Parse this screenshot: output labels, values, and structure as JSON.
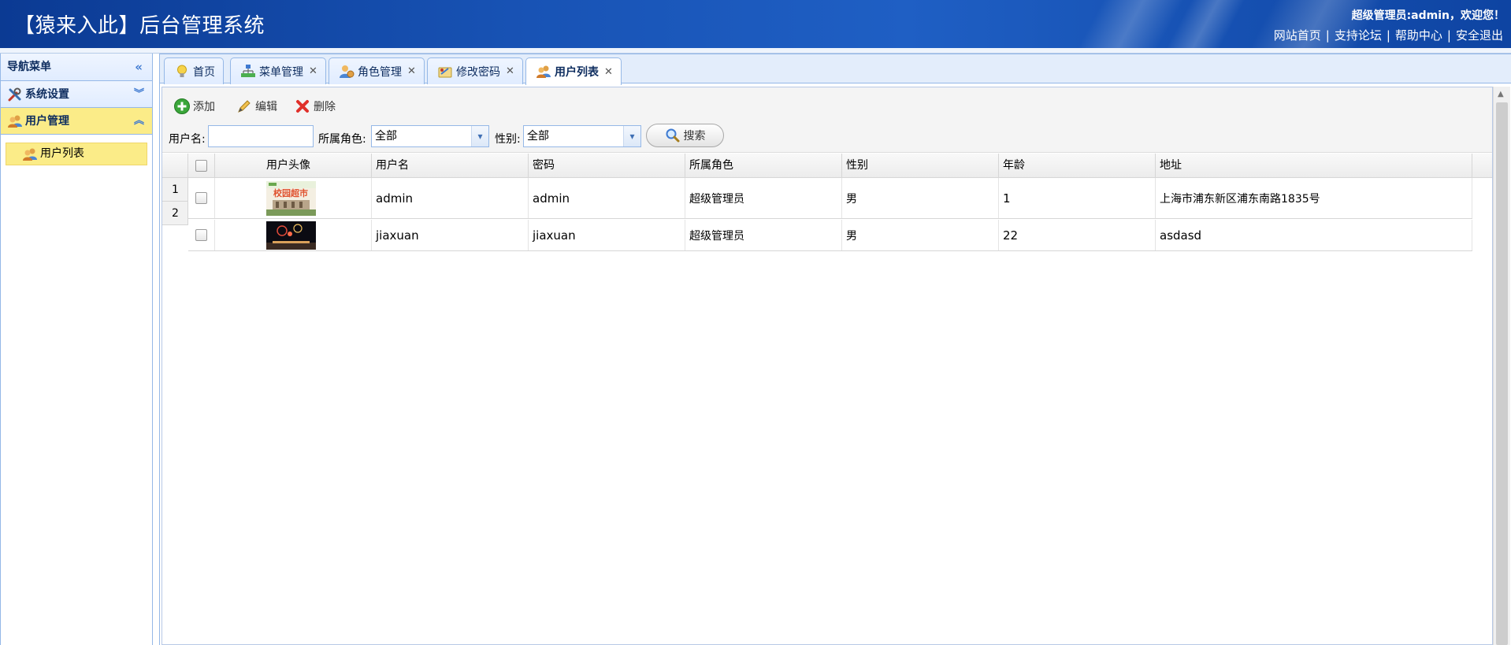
{
  "header": {
    "title": "【猿来入此】后台管理系统",
    "welcome": "超级管理员:admin，欢迎您！",
    "links": [
      "网站首页",
      "支持论坛",
      "帮助中心",
      "安全退出"
    ]
  },
  "sidebar": {
    "title": "导航菜单",
    "sections": [
      {
        "label": "系统设置",
        "icon": "tools-icon",
        "expanded": false
      },
      {
        "label": "用户管理",
        "icon": "users-icon",
        "expanded": true
      }
    ],
    "items": [
      {
        "label": "用户列表",
        "icon": "users-icon",
        "selected": true
      }
    ]
  },
  "tabs": [
    {
      "label": "首页",
      "icon": "lightbulb-icon",
      "closable": false,
      "selected": false
    },
    {
      "label": "菜单管理",
      "icon": "sitemap-icon",
      "closable": true,
      "selected": false
    },
    {
      "label": "角色管理",
      "icon": "role-icon",
      "closable": true,
      "selected": false
    },
    {
      "label": "修改密码",
      "icon": "password-icon",
      "closable": true,
      "selected": false
    },
    {
      "label": "用户列表",
      "icon": "users-icon",
      "closable": true,
      "selected": true
    }
  ],
  "toolbar": {
    "add_label": "添加",
    "edit_label": "编辑",
    "delete_label": "删除"
  },
  "filters": {
    "username_label": "用户名:",
    "username_value": "",
    "role_label": "所属角色:",
    "role_value": "全部",
    "sex_label": "性别:",
    "sex_value": "全部",
    "search_label": "搜索"
  },
  "grid": {
    "columns": [
      "用户头像",
      "用户名",
      "密码",
      "所属角色",
      "性别",
      "年龄",
      "地址"
    ],
    "row_numbers": [
      "1",
      "2"
    ],
    "rows": [
      {
        "username": "admin",
        "password": "admin",
        "role": "超级管理员",
        "sex": "男",
        "age": "1",
        "address": "上海市浦东新区浦东南路1835号",
        "avatar_text": "校园超市"
      },
      {
        "username": "jiaxuan",
        "password": "jiaxuan",
        "role": "超级管理员",
        "sex": "男",
        "age": "22",
        "address": "asdasd",
        "avatar_text": ""
      }
    ]
  },
  "colors": {
    "header_blue": "#1853b5",
    "panel_border": "#95b8e7",
    "selected_yellow": "#fbec88"
  }
}
